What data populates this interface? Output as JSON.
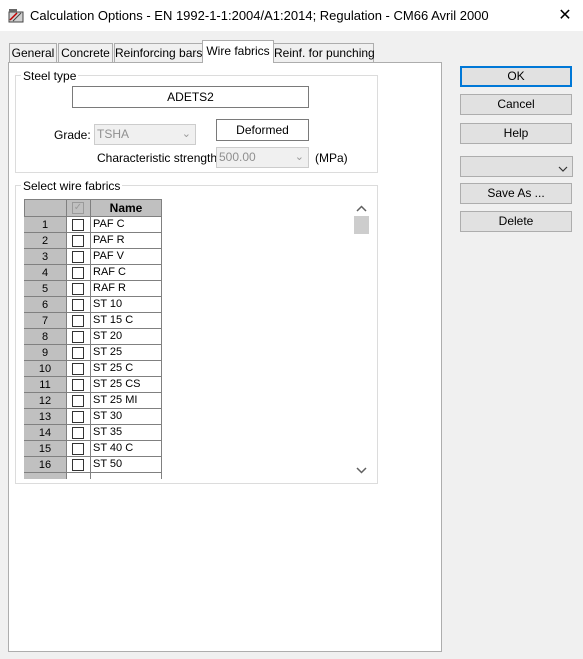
{
  "window": {
    "title": "Calculation Options - EN 1992-1-1:2004/A1:2014;  Regulation - CM66 Avril 2000",
    "close_glyph": "✕"
  },
  "tabs": [
    {
      "label": "General",
      "active": false
    },
    {
      "label": "Concrete",
      "active": false
    },
    {
      "label": "Reinforcing bars",
      "active": false
    },
    {
      "label": "Wire fabrics",
      "active": true
    },
    {
      "label": "Reinf. for punching",
      "active": false
    }
  ],
  "steel_type": {
    "group_label": "Steel type",
    "name_value": "ADETS2",
    "grade_label": "Grade:",
    "grade_value": "TSHA",
    "surface_button": "Deformed",
    "char_strength_label": "Characteristic strength",
    "char_strength_value": "500.00",
    "unit": "(MPa)"
  },
  "wire_fabrics": {
    "group_label": "Select wire fabrics",
    "name_header": "Name",
    "rows": [
      {
        "num": "1",
        "name": "PAF C",
        "checked": false
      },
      {
        "num": "2",
        "name": "PAF R",
        "checked": false
      },
      {
        "num": "3",
        "name": "PAF V",
        "checked": false
      },
      {
        "num": "4",
        "name": "RAF C",
        "checked": false
      },
      {
        "num": "5",
        "name": "RAF R",
        "checked": false
      },
      {
        "num": "6",
        "name": "ST 10",
        "checked": false
      },
      {
        "num": "7",
        "name": "ST 15 C",
        "checked": false
      },
      {
        "num": "8",
        "name": "ST 20",
        "checked": false
      },
      {
        "num": "9",
        "name": "ST 25",
        "checked": false
      },
      {
        "num": "10",
        "name": "ST 25 C",
        "checked": false
      },
      {
        "num": "11",
        "name": "ST 25 CS",
        "checked": false
      },
      {
        "num": "12",
        "name": "ST 25 MI",
        "checked": false
      },
      {
        "num": "13",
        "name": "ST 30",
        "checked": false
      },
      {
        "num": "14",
        "name": "ST 35",
        "checked": false
      },
      {
        "num": "15",
        "name": "ST 40 C",
        "checked": false
      },
      {
        "num": "16",
        "name": "ST 50",
        "checked": false
      }
    ]
  },
  "buttons": {
    "ok": "OK",
    "cancel": "Cancel",
    "help": "Help",
    "save_as": "Save As ...",
    "delete": "Delete"
  },
  "colors": {
    "accent": "#0078d7",
    "header_gray": "#c0c0c0"
  }
}
